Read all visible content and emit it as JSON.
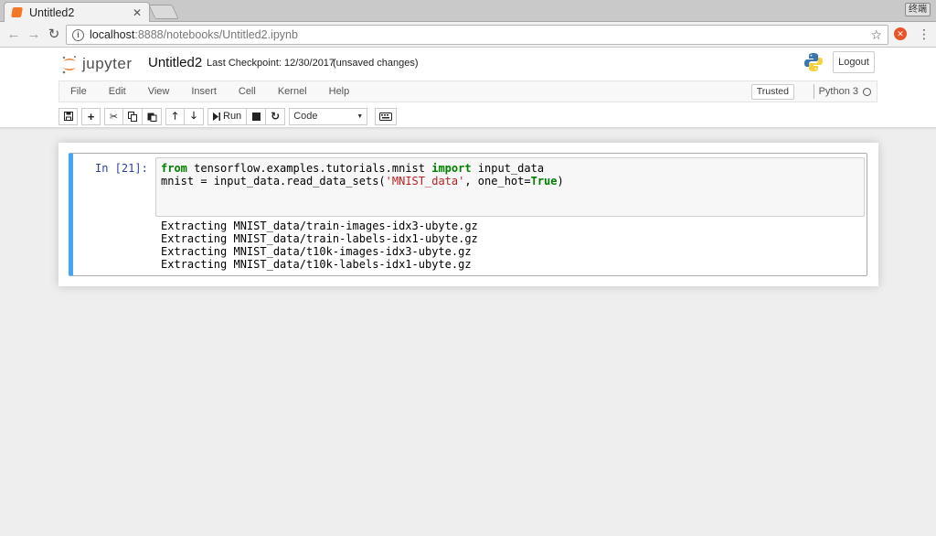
{
  "browser": {
    "tab_title": "Untitled2",
    "tab_close": "✕",
    "window_button": "终端",
    "url_host": "localhost",
    "url_path": ":8888/notebooks/Untitled2.ipynb"
  },
  "header": {
    "logo_text": "jupyter",
    "notebook_title": "Untitled2",
    "checkpoint": "Last Checkpoint: 12/30/2017",
    "save_status": "(unsaved changes)",
    "logout_label": "Logout"
  },
  "menubar": {
    "items": [
      "File",
      "Edit",
      "View",
      "Insert",
      "Cell",
      "Kernel",
      "Help"
    ],
    "trusted_label": "Trusted",
    "kernel_name": "Python 3"
  },
  "toolbar": {
    "run_label": "Run",
    "cell_type": "Code"
  },
  "cell": {
    "prompt": "In [21]:",
    "code": {
      "line1_kw1": "from",
      "line1_mod": " tensorflow.examples.tutorials.mnist ",
      "line1_kw2": "import",
      "line1_name": " input_data",
      "line2_pre": "mnist = input_data.read_data_sets(",
      "line2_str": "'MNIST_data'",
      "line2_mid": ", one_hot=",
      "line2_kw": "True",
      "line2_end": ")"
    },
    "output": [
      "Extracting MNIST_data/train-images-idx3-ubyte.gz",
      "Extracting MNIST_data/train-labels-idx1-ubyte.gz",
      "Extracting MNIST_data/t10k-images-idx3-ubyte.gz",
      "Extracting MNIST_data/t10k-labels-idx1-ubyte.gz"
    ]
  },
  "colors": {
    "accent_orange": "#f37726",
    "cell_selected_border": "#42a5f5",
    "prompt_in": "#303f9f",
    "keyword": "#008000",
    "string": "#ba2121"
  }
}
